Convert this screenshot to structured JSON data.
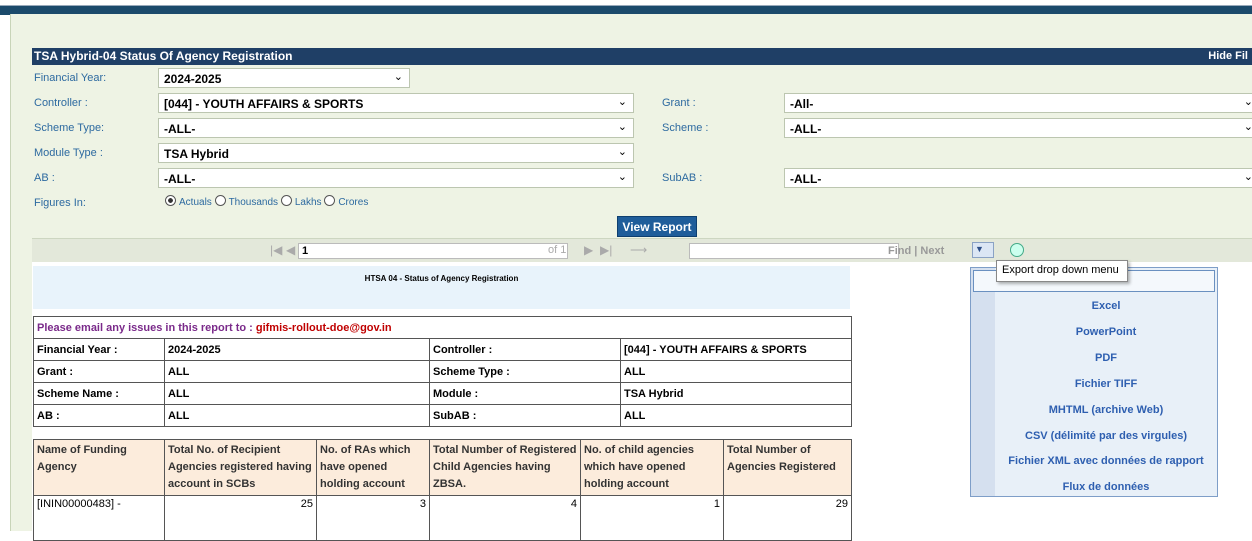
{
  "report_title": "TSA Hybrid-04 Status Of Agency Registration",
  "hide_filters": "Hide Fil",
  "filters": {
    "financial_year": {
      "label": "Financial Year:",
      "value": "2024-2025"
    },
    "controller": {
      "label": "Controller :",
      "value": "[044] - YOUTH AFFAIRS & SPORTS"
    },
    "grant": {
      "label": "Grant :",
      "value": "-All-"
    },
    "scheme_type": {
      "label": "Scheme Type:",
      "value": "-ALL-"
    },
    "scheme": {
      "label": "Scheme :",
      "value": "-ALL-"
    },
    "module_type": {
      "label": "Module Type :",
      "value": "TSA Hybrid"
    },
    "ab": {
      "label": "AB :",
      "value": "-ALL-"
    },
    "subab": {
      "label": "SubAB :",
      "value": "-ALL-"
    },
    "figures_in": {
      "label": "Figures In:",
      "options": [
        "Actuals",
        "Thousands",
        "Lakhs",
        "Crores"
      ],
      "selected": "Actuals"
    }
  },
  "view_report": "View Report",
  "toolbar": {
    "page": "1",
    "of_pages": "of 1",
    "find": "Find",
    "separator": "|",
    "next": "Next"
  },
  "export_tooltip": "Export drop down menu",
  "export_menu": [
    "Excel",
    "PowerPoint",
    "PDF",
    "Fichier TIFF",
    "MHTML (archive Web)",
    "CSV (délimité par des virgules)",
    "Fichier XML avec données de rapport",
    "Flux de données"
  ],
  "report": {
    "header": "HTSA 04 - Status of Agency Registration",
    "email_prefix": "Please email any issues in this report to : ",
    "email": "gifmis-rollout-doe@gov.in",
    "info": {
      "financial_year_label": "Financial Year :",
      "financial_year": "2024-2025",
      "controller_label": "Controller :",
      "controller": "[044] - YOUTH AFFAIRS & SPORTS",
      "grant_label": "Grant :",
      "grant": "ALL",
      "scheme_type_label": "Scheme Type :",
      "scheme_type": "ALL",
      "scheme_name_label": "Scheme Name :",
      "scheme_name": "ALL",
      "module_label": "Module :",
      "module": "TSA Hybrid",
      "ab_label": "AB :",
      "ab": "ALL",
      "subab_label": "SubAB :",
      "subab": "ALL"
    },
    "columns": [
      "Name of Funding Agency",
      "Total No. of Recipient Agencies registered having account in SCBs",
      "No. of RAs which have opened holding account",
      "Total Number of Registered Child Agencies having ZBSA.",
      "No. of child agencies which have opened holding account",
      "Total Number of Agencies Registered"
    ],
    "rows": [
      {
        "name": "[ININ00000483] -",
        "c1": "25",
        "c2": "3",
        "c3": "4",
        "c4": "1",
        "c5": "29"
      }
    ]
  }
}
